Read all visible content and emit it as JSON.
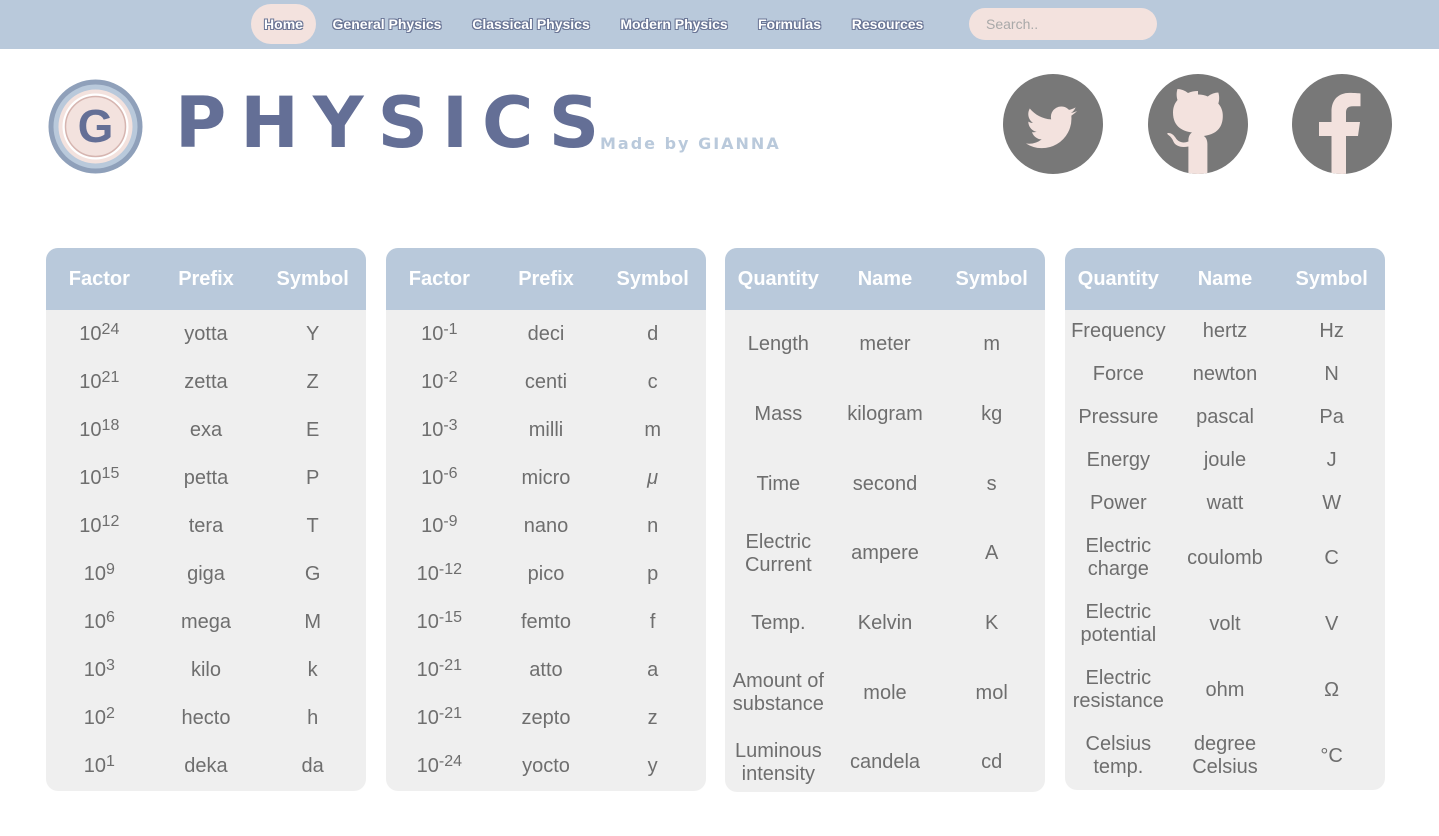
{
  "nav": {
    "items": [
      {
        "label": "Home",
        "active": true
      },
      {
        "label": "General Physics"
      },
      {
        "label": "Classical Physics"
      },
      {
        "label": "Modern Physics"
      },
      {
        "label": "Formulas"
      },
      {
        "label": "Resources"
      }
    ],
    "search_placeholder": "Search..",
    "colors": {
      "bar": "#b9c9db",
      "active_pill": "#f3e2de"
    }
  },
  "header": {
    "logo_letter": "G",
    "brand": "PHYSICS",
    "made_by": "Made by",
    "author": "GIANNA",
    "social": [
      "twitter-icon",
      "github-icon",
      "facebook-icon"
    ]
  },
  "tables": {
    "prefix_large": {
      "headers": [
        "Factor",
        "Prefix",
        "Symbol"
      ],
      "rows": [
        {
          "base": "10",
          "exp": "24",
          "prefix": "yotta",
          "symbol": "Y"
        },
        {
          "base": "10",
          "exp": "21",
          "prefix": "zetta",
          "symbol": "Z"
        },
        {
          "base": "10",
          "exp": "18",
          "prefix": "exa",
          "symbol": "E"
        },
        {
          "base": "10",
          "exp": "15",
          "prefix": "petta",
          "symbol": "P"
        },
        {
          "base": "10",
          "exp": "12",
          "prefix": "tera",
          "symbol": "T"
        },
        {
          "base": "10",
          "exp": "9",
          "prefix": "giga",
          "symbol": "G"
        },
        {
          "base": "10",
          "exp": "6",
          "prefix": "mega",
          "symbol": "M"
        },
        {
          "base": "10",
          "exp": "3",
          "prefix": "kilo",
          "symbol": "k"
        },
        {
          "base": "10",
          "exp": "2",
          "prefix": "hecto",
          "symbol": "h"
        },
        {
          "base": "10",
          "exp": "1",
          "prefix": "deka",
          "symbol": "da"
        }
      ]
    },
    "prefix_small": {
      "headers": [
        "Factor",
        "Prefix",
        "Symbol"
      ],
      "rows": [
        {
          "base": "10",
          "exp": "-1",
          "prefix": "deci",
          "symbol": "d"
        },
        {
          "base": "10",
          "exp": "-2",
          "prefix": "centi",
          "symbol": "c"
        },
        {
          "base": "10",
          "exp": "-3",
          "prefix": "milli",
          "symbol": "m"
        },
        {
          "base": "10",
          "exp": "-6",
          "prefix": "micro",
          "symbol": "μ"
        },
        {
          "base": "10",
          "exp": "-9",
          "prefix": "nano",
          "symbol": "n"
        },
        {
          "base": "10",
          "exp": "-12",
          "prefix": "pico",
          "symbol": "p"
        },
        {
          "base": "10",
          "exp": "-15",
          "prefix": "femto",
          "symbol": "f"
        },
        {
          "base": "10",
          "exp": "-21",
          "prefix": "atto",
          "symbol": "a"
        },
        {
          "base": "10",
          "exp": "-21",
          "prefix": "zepto",
          "symbol": "z"
        },
        {
          "base": "10",
          "exp": "-24",
          "prefix": "yocto",
          "symbol": "y"
        }
      ]
    },
    "base_units": {
      "headers": [
        "Quantity",
        "Name",
        "Symbol"
      ],
      "rows": [
        {
          "quantity": [
            "Length"
          ],
          "name": [
            "meter"
          ],
          "symbol": "m"
        },
        {
          "quantity": [
            "Mass"
          ],
          "name": [
            "kilogram"
          ],
          "symbol": "kg"
        },
        {
          "quantity": [
            "Time"
          ],
          "name": [
            "second"
          ],
          "symbol": "s"
        },
        {
          "quantity": [
            "Electric",
            "Current"
          ],
          "name": [
            "ampere"
          ],
          "symbol": "A"
        },
        {
          "quantity": [
            "Temp."
          ],
          "name": [
            "Kelvin"
          ],
          "symbol": "K"
        },
        {
          "quantity": [
            "Amount of",
            "substance"
          ],
          "name": [
            "mole"
          ],
          "symbol": "mol"
        },
        {
          "quantity": [
            "Luminous",
            "intensity"
          ],
          "name": [
            "candela"
          ],
          "symbol": "cd"
        }
      ]
    },
    "derived_units": {
      "headers": [
        "Quantity",
        "Name",
        "Symbol"
      ],
      "rows": [
        {
          "quantity": [
            "Frequency"
          ],
          "name": [
            "hertz"
          ],
          "symbol": "Hz"
        },
        {
          "quantity": [
            "Force"
          ],
          "name": [
            "newton"
          ],
          "symbol": "N"
        },
        {
          "quantity": [
            "Pressure"
          ],
          "name": [
            "pascal"
          ],
          "symbol": "Pa"
        },
        {
          "quantity": [
            "Energy"
          ],
          "name": [
            "joule"
          ],
          "symbol": "J"
        },
        {
          "quantity": [
            "Power"
          ],
          "name": [
            "watt"
          ],
          "symbol": "W"
        },
        {
          "quantity": [
            "Electric",
            "charge"
          ],
          "name": [
            "coulomb"
          ],
          "symbol": "C"
        },
        {
          "quantity": [
            "Electric",
            "potential"
          ],
          "name": [
            "volt"
          ],
          "symbol": "V"
        },
        {
          "quantity": [
            "Electric",
            "resistance"
          ],
          "name": [
            "ohm"
          ],
          "symbol": "Ω"
        },
        {
          "quantity": [
            "Celsius",
            "temp."
          ],
          "name": [
            "degree",
            "Celsius"
          ],
          "symbol": "°C"
        }
      ]
    }
  }
}
